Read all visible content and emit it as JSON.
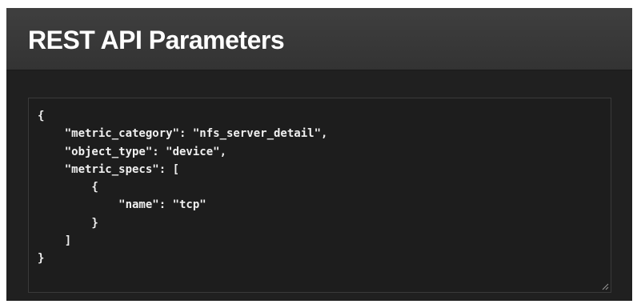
{
  "panel": {
    "title": "REST API Parameters"
  },
  "code": {
    "text": "{\n    \"metric_category\": \"nfs_server_detail\",\n    \"object_type\": \"device\",\n    \"metric_specs\": [\n        {\n            \"name\": \"tcp\"\n        }\n    ]\n}"
  },
  "icons": {
    "resize": "resize-grip-icon"
  },
  "colors": {
    "panel_background": "#202020",
    "header_background": "#3a3a3a",
    "title_text": "#ffffff",
    "code_text": "#f0f0f0",
    "code_border": "#3a3a3a"
  }
}
